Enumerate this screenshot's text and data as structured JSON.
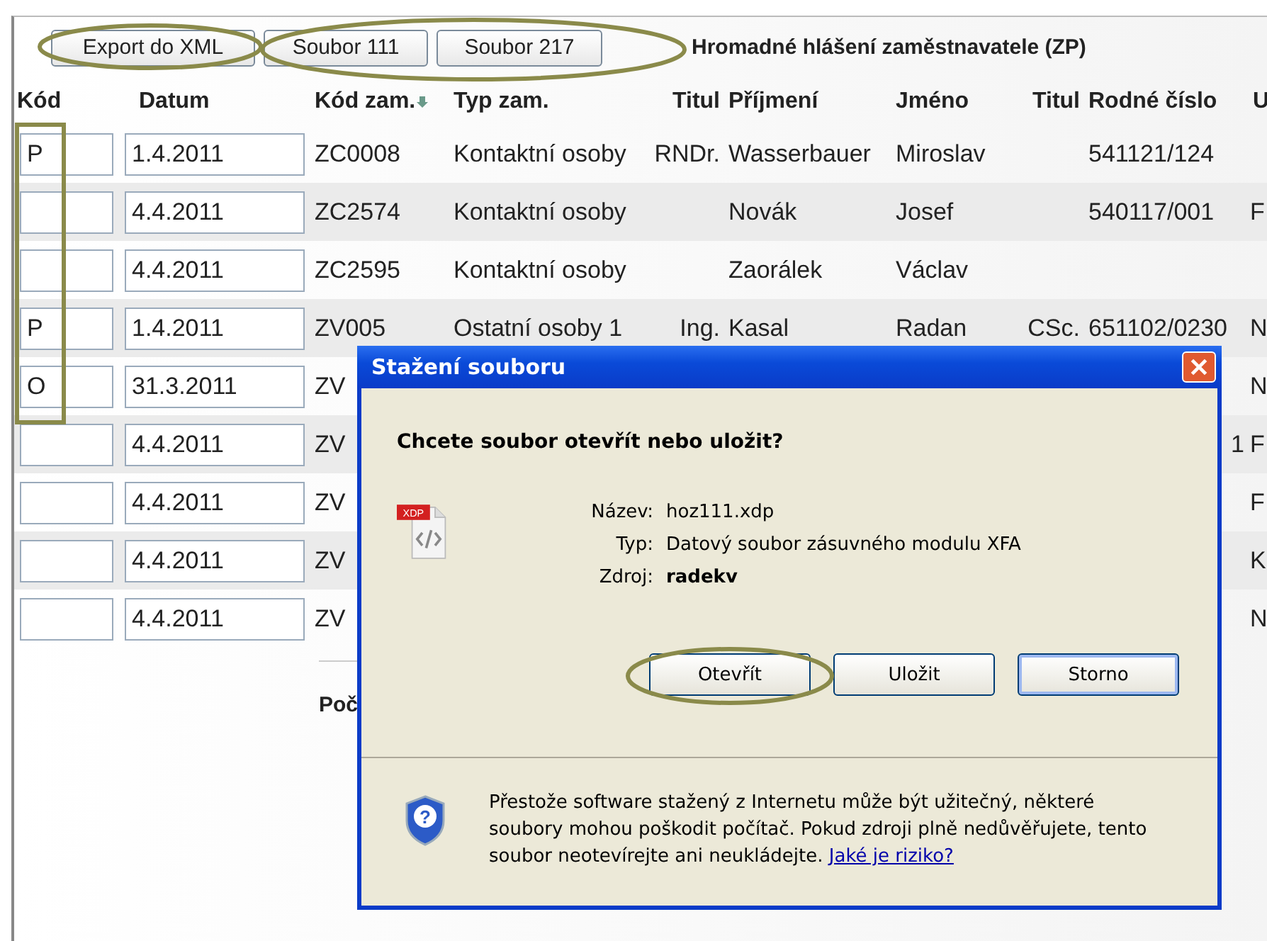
{
  "toolbar": {
    "buttons": [
      "Export do XML",
      "Soubor 111",
      "Soubor 217"
    ],
    "title": "Hromadné hlášení zaměstnavatele (ZP)"
  },
  "table": {
    "columns": [
      {
        "label": "Kód",
        "sorted": false
      },
      {
        "label": "Datum",
        "sorted": false
      },
      {
        "label": "Kód zam.",
        "sorted": true
      },
      {
        "label": "Typ zam.",
        "sorted": false
      },
      {
        "label": "Titul",
        "sorted": false
      },
      {
        "label": "Příjmení",
        "sorted": false
      },
      {
        "label": "Jméno",
        "sorted": false
      },
      {
        "label": "Titul",
        "sorted": false
      },
      {
        "label": "Rodné číslo",
        "sorted": false
      },
      {
        "label": "U",
        "sorted": false
      }
    ],
    "rows": [
      {
        "kod": "P",
        "datum": "1.4.2011",
        "kod_zam": "ZC0008",
        "typ_zam": "Kontaktní osoby",
        "titul": "RNDr.",
        "prijmeni": "Wasserbauer",
        "jmeno": "Miroslav",
        "rodne_cislo": "541121/124"
      },
      {
        "datum": "4.4.2011",
        "kod_zam": "ZC2574",
        "typ_zam": "Kontaktní osoby",
        "prijmeni": "Novák",
        "jmeno": "Josef",
        "rodne_cislo": "540117/001",
        "column_u": "F"
      },
      {
        "datum": "4.4.2011",
        "kod_zam": "ZC2595",
        "typ_zam": "Kontaktní osoby",
        "prijmeni": "Zaorálek",
        "jmeno": "Václav"
      },
      {
        "kod": "P",
        "datum": "1.4.2011",
        "kod_zam": "ZV005",
        "typ_zam": "Ostatní osoby 1",
        "titul": "Ing.",
        "prijmeni": "Kasal",
        "jmeno": "Radan",
        "titul_2": "CSc.",
        "rodne_cislo": "651102/0230",
        "column_u": "N"
      },
      {
        "kod": "O",
        "datum": "31.3.2011",
        "kod_zam": "ZV",
        "column_u": "N"
      },
      {
        "datum": "4.4.2011",
        "kod_zam": "ZV",
        "rodne_cislo_end": "1",
        "column_u": "F"
      },
      {
        "datum": "4.4.2011",
        "kod_zam": "ZV",
        "column_u": "F"
      },
      {
        "datum": "4.4.2011",
        "kod_zam": "ZV",
        "column_u": "K"
      },
      {
        "datum": "4.4.2011",
        "kod_zam": "ZV",
        "column_u": "N"
      }
    ],
    "footer": "Poč"
  },
  "dialog": {
    "title": "Stažení souboru",
    "question": "Chcete soubor otevřít nebo uložit?",
    "file_badge": "XDP",
    "fields": [
      {
        "label": "Název:",
        "value": "hoz111.xdp",
        "bold": false
      },
      {
        "label": "Typ:",
        "value": "Datový soubor zásuvného modulu XFA",
        "bold": false
      },
      {
        "label": "Zdroj:",
        "value": "radekv",
        "bold": true
      }
    ],
    "buttons": [
      {
        "label": "Otevřít",
        "default": false
      },
      {
        "label": "Uložit",
        "default": false
      },
      {
        "label": "Storno",
        "default": true
      }
    ],
    "shield_glyph": "?",
    "warning": "Přestože software stažený z Internetu může být užitečný, některé soubory mohou poškodit počítač. Pokud zdroji plně nedůvěřujete, tento soubor neotevírejte ani neukládejte.",
    "warning_link": "Jaké je riziko?"
  }
}
